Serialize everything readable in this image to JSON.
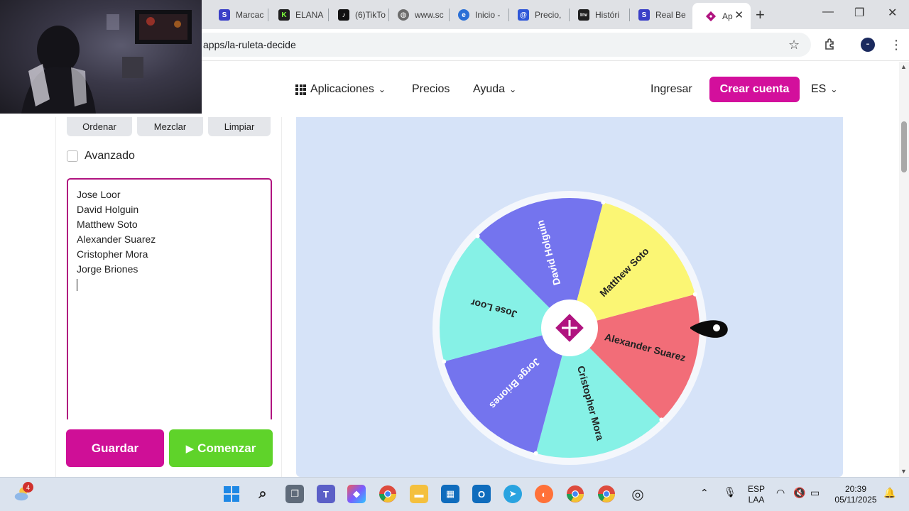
{
  "browser": {
    "tabs": [
      {
        "label": "Marcac",
        "icon": "s-logo-icon",
        "color": "#3a3fc7"
      },
      {
        "label": "ELANA",
        "icon": "k-logo-icon",
        "color": "#1f1f1f"
      },
      {
        "label": "(6)TikTo",
        "icon": "tiktok-icon",
        "color": "#111111"
      },
      {
        "label": "www.sc",
        "icon": "globe-icon",
        "color": "#6b6b6b"
      },
      {
        "label": "Inicio -",
        "icon": "e-logo-icon",
        "color": "#2a6fd6"
      },
      {
        "label": "Precio,",
        "icon": "at-icon",
        "color": "#2f57d8"
      },
      {
        "label": "Históri",
        "icon": "inv-logo-icon",
        "color": "#1f1f1f"
      },
      {
        "label": "Real Be",
        "icon": "s-logo-icon",
        "color": "#3a3fc7"
      },
      {
        "label": "Ap",
        "icon": "diamond-logo-icon",
        "color": "#b0137f",
        "active": true
      }
    ],
    "url": "apps/la-ruleta-decide"
  },
  "site_nav": {
    "apps": "Aplicaciones",
    "pricing": "Precios",
    "help": "Ayuda",
    "login": "Ingresar",
    "signup": "Crear cuenta",
    "lang": "ES"
  },
  "editor": {
    "sort": "Ordenar",
    "shuffle": "Mezclar",
    "clear": "Limpiar",
    "advanced": "Avanzado",
    "names": [
      "Jose Loor",
      "David Holguin",
      "Matthew Soto",
      "Alexander Suarez",
      "Cristopher Mora",
      "Jorge Briones"
    ],
    "save": "Guardar",
    "start": "Comenzar"
  },
  "wheel": {
    "segments": [
      {
        "label": "Alexander Suarez",
        "color": "#f26d78",
        "text_color": "#222222"
      },
      {
        "label": "Cristopher Mora",
        "color": "#86f1e6",
        "text_color": "#222222"
      },
      {
        "label": "Jorge Briones",
        "color": "#7474ee",
        "text_color": "#ffffff"
      },
      {
        "label": "Jose Loor",
        "color": "#86f1e6",
        "text_color": "#222222"
      },
      {
        "label": "David Holguin",
        "color": "#7474ee",
        "text_color": "#ffffff"
      },
      {
        "label": "Matthew Soto",
        "color": "#fbf674",
        "text_color": "#222222"
      }
    ],
    "hub_color": "#b0137f"
  },
  "taskbar": {
    "weather_badge": "4",
    "lang_top": "ESP",
    "lang_bottom": "LAA",
    "time": "20:39",
    "date": "05/11/2025"
  }
}
